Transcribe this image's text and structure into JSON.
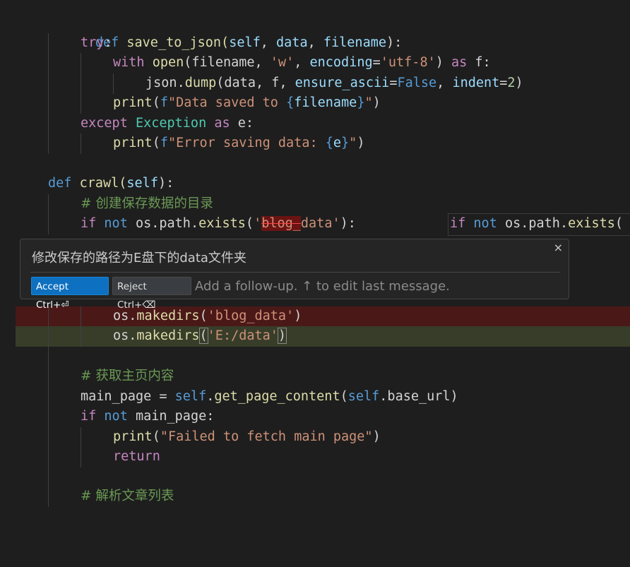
{
  "code": {
    "l1": {
      "def": "def",
      "name": "save_to_json",
      "open": "(",
      "p1": "self",
      "c1": ", ",
      "p2": "data",
      "c2": ", ",
      "p3": "filename",
      "close": "):"
    },
    "l2": {
      "kw": "try",
      "colon": ":"
    },
    "l3": {
      "kw": "with",
      "fn": "open",
      "p": "(filename, ",
      "s1": "'w'",
      "c": ", ",
      "arg": "encoding",
      "eq": "=",
      "s2": "'utf-8'",
      "close": ") ",
      "as": "as",
      "var": " f:"
    },
    "l4": {
      "obj": "json",
      "dot": ".",
      "fn": "dump",
      "a": "(data, f, ",
      "arg1": "ensure_ascii",
      "eq1": "=",
      "v1": "False",
      "c": ", ",
      "arg2": "indent",
      "eq2": "=",
      "v2": "2",
      "close": ")"
    },
    "l5": {
      "fn": "print",
      "open": "(",
      "f": "f",
      "s1": "\"Data saved to ",
      "b1": "{",
      "v": "filename",
      "b2": "}",
      "s2": "\"",
      "close": ")"
    },
    "l6": {
      "kw": "except",
      "cls": "Exception",
      "as": "as",
      "var": " e:"
    },
    "l7": {
      "fn": "print",
      "open": "(",
      "f": "f",
      "s1": "\"Error saving data: ",
      "b1": "{",
      "v": "e",
      "b2": "}",
      "s2": "\"",
      "close": ")"
    },
    "l9": {
      "def": "def",
      "name": "crawl",
      "open": "(",
      "p1": "self",
      "close": "):"
    },
    "l10": {
      "comment": "# 创建保存数据的目录"
    },
    "l11": {
      "kw1": "if",
      "kw2": "not",
      "path": " os.path.",
      "fn": "exists",
      "open": "(",
      "s1": "'",
      "strike": "blog_",
      "s2": "data'",
      "close": "):"
    },
    "ghost": {
      "kw1": "if",
      "kw2": "not",
      "path": " os.path.",
      "fn": "exists",
      "open": "("
    },
    "l13": {
      "obj": "os",
      "dot": ".",
      "fn": "makedirs",
      "open": "(",
      "s": "'blog_data'",
      "close": ")"
    },
    "l14": {
      "obj": "os",
      "dot": ".",
      "fn": "makedirs",
      "open": "(",
      "s": "'E:/data'",
      "close": ")"
    },
    "l16": {
      "comment": "# 获取主页内容"
    },
    "l17": {
      "var": "main_page",
      "eq": " = ",
      "self1": "self",
      "dot": ".",
      "fn": "get_page_content",
      "open": "(",
      "self2": "self",
      "attr": ".base_url",
      "close": ")"
    },
    "l18": {
      "kw1": "if",
      "kw2": "not",
      "var": " main_page:"
    },
    "l19": {
      "fn": "print",
      "open": "(",
      "s": "\"Failed to fetch main page\"",
      "close": ")"
    },
    "l20": {
      "kw": "return"
    },
    "l22": {
      "comment": "# 解析文章列表"
    }
  },
  "chat": {
    "message": "修改保存的路径为E盘下的data文件夹",
    "accept_label": "Accept Ctrl+⏎",
    "reject_label": "Reject Ctrl+⌫",
    "followup_placeholder": "Add a follow-up. ↑ to edit last message.",
    "close_glyph": "×"
  },
  "colors": {
    "background": "#1e1e1e",
    "keyword": "#c586c0",
    "def": "#569cd6",
    "function": "#dcdcaa",
    "param": "#9cdcfe",
    "string": "#ce9178",
    "comment": "#6a9955",
    "removed_bg": "#4b1818",
    "added_bg": "#373d29",
    "accept_btn": "#0e70c0"
  }
}
